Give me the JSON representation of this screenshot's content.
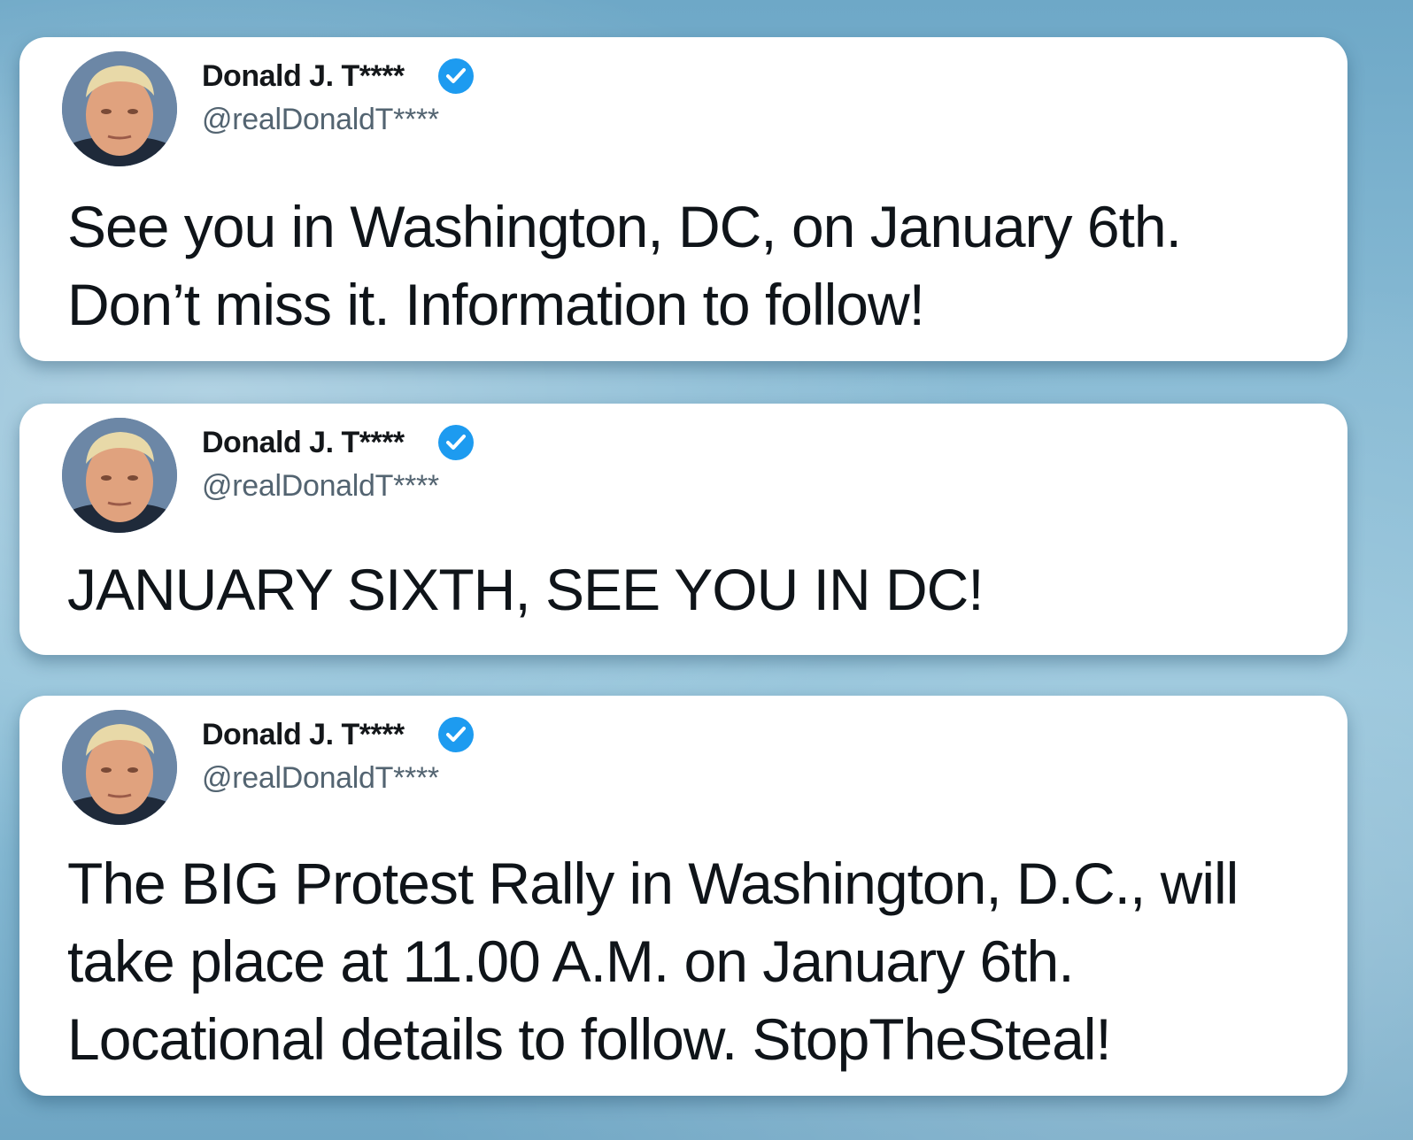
{
  "colors": {
    "verified_badge": "#1d9bf0",
    "card_background": "#ffffff",
    "name_text": "#14171a",
    "handle_text": "#536471"
  },
  "tweets": [
    {
      "author": {
        "display_name": "Donald J. T****",
        "handle": "@realDonaldT****",
        "avatar_icon": "avatar-photo",
        "verified_icon": "verified-badge-icon"
      },
      "text": "See you in Washington, DC, on January 6th. Don’t miss it. Information to follow!"
    },
    {
      "author": {
        "display_name": "Donald J. T****",
        "handle": "@realDonaldT****",
        "avatar_icon": "avatar-photo",
        "verified_icon": "verified-badge-icon"
      },
      "text": "JANUARY SIXTH, SEE YOU IN DC!"
    },
    {
      "author": {
        "display_name": "Donald J. T****",
        "handle": "@realDonaldT****",
        "avatar_icon": "avatar-photo",
        "verified_icon": "verified-badge-icon"
      },
      "text": "The BIG Protest Rally in Washington, D.C., will take place at 11.00 A.M. on January 6th. Locational details to follow. StopTheSteal!"
    }
  ]
}
